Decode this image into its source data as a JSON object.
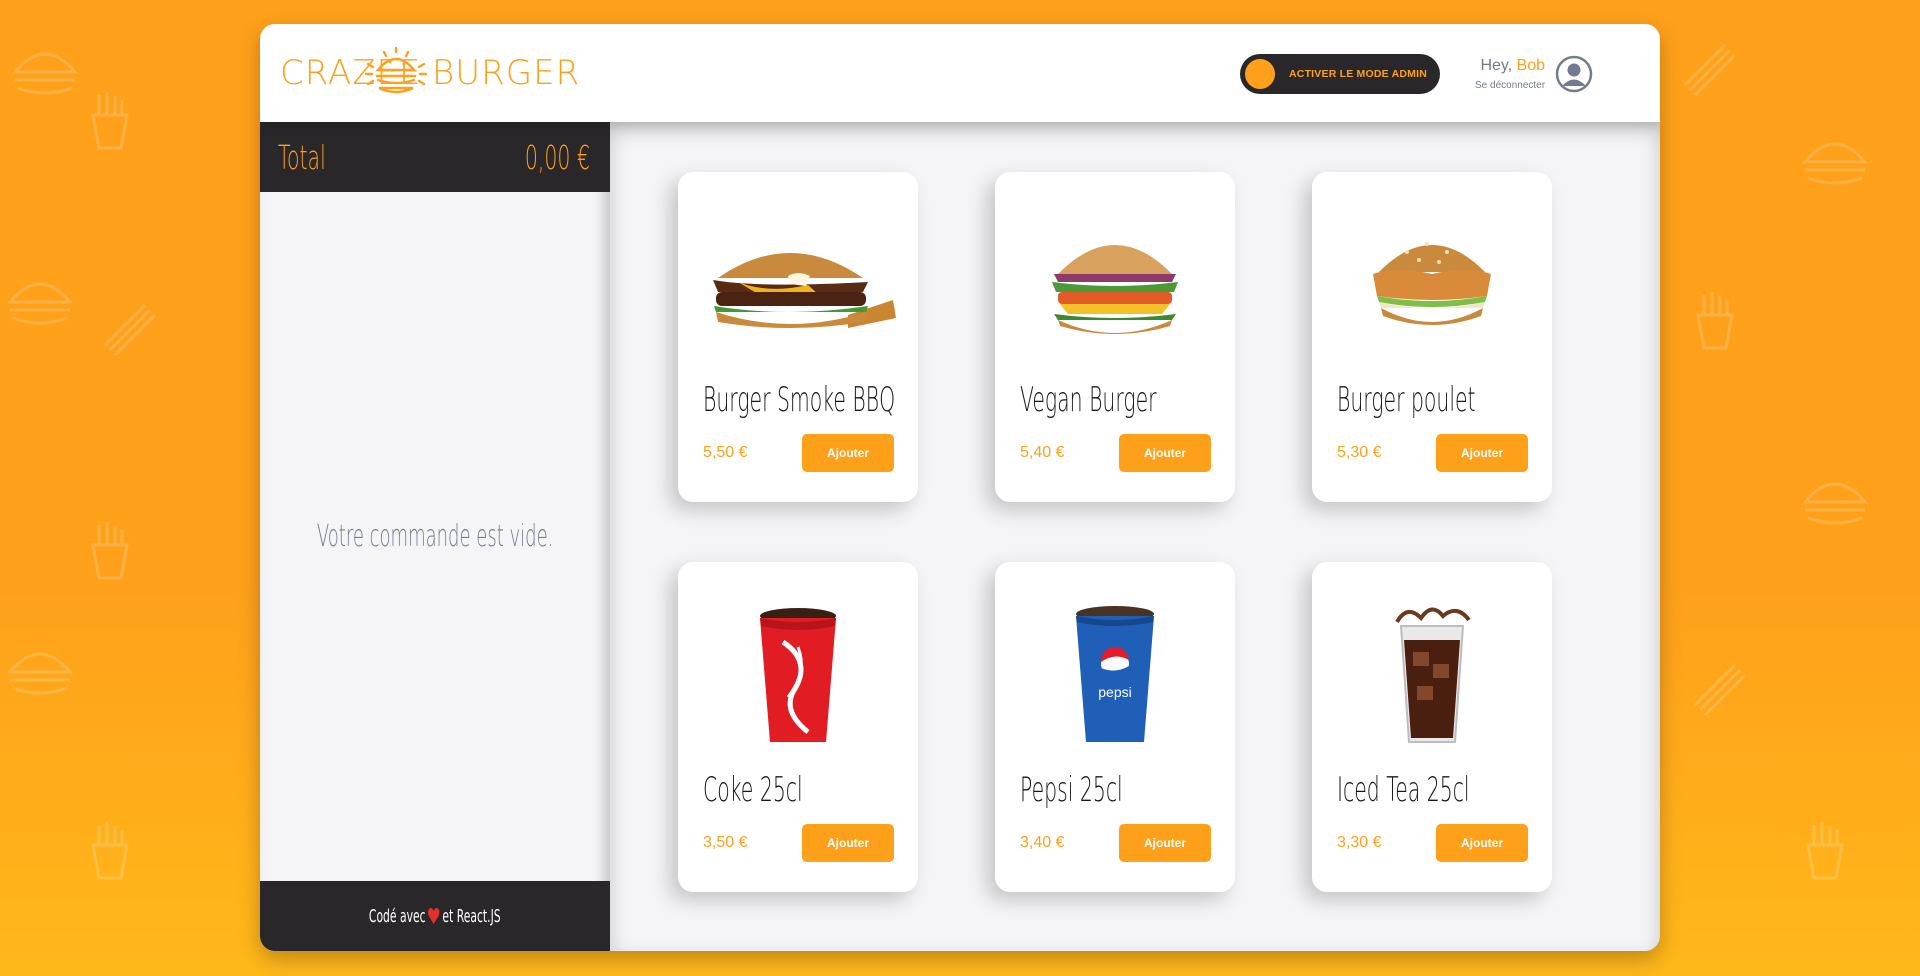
{
  "brand": {
    "left": "Crazee",
    "right": "Burger"
  },
  "admin_toggle": {
    "label": "ACTIVER LE MODE ADMIN"
  },
  "profile": {
    "greeting": "Hey, ",
    "name": "Bob",
    "logout": "Se déconnecter"
  },
  "basket": {
    "total_label": "Total",
    "total_amount": "0,00 €",
    "empty_message": "Votre commande est vide.",
    "footer_prefix": "Codé avec",
    "footer_suffix": "et React.JS"
  },
  "products": [
    {
      "title": "Burger Smoke BBQ",
      "price": "5,50 €",
      "button": "Ajouter",
      "image": "burger-smoke-bbq"
    },
    {
      "title": "Vegan Burger",
      "price": "5,40 €",
      "button": "Ajouter",
      "image": "vegan-burger"
    },
    {
      "title": "Burger poulet",
      "price": "5,30 €",
      "button": "Ajouter",
      "image": "chicken-burger"
    },
    {
      "title": "Coke 25cl",
      "price": "3,50 €",
      "button": "Ajouter",
      "image": "coke-cup"
    },
    {
      "title": "Pepsi 25cl",
      "price": "3,40 €",
      "button": "Ajouter",
      "image": "pepsi-cup"
    },
    {
      "title": "Iced Tea 25cl",
      "price": "3,30 €",
      "button": "Ajouter",
      "image": "iced-tea-glass"
    }
  ],
  "colors": {
    "primary": "#ffa01b",
    "dark": "#292729",
    "greyText": "#747b91",
    "background": "#f5f5f7"
  }
}
